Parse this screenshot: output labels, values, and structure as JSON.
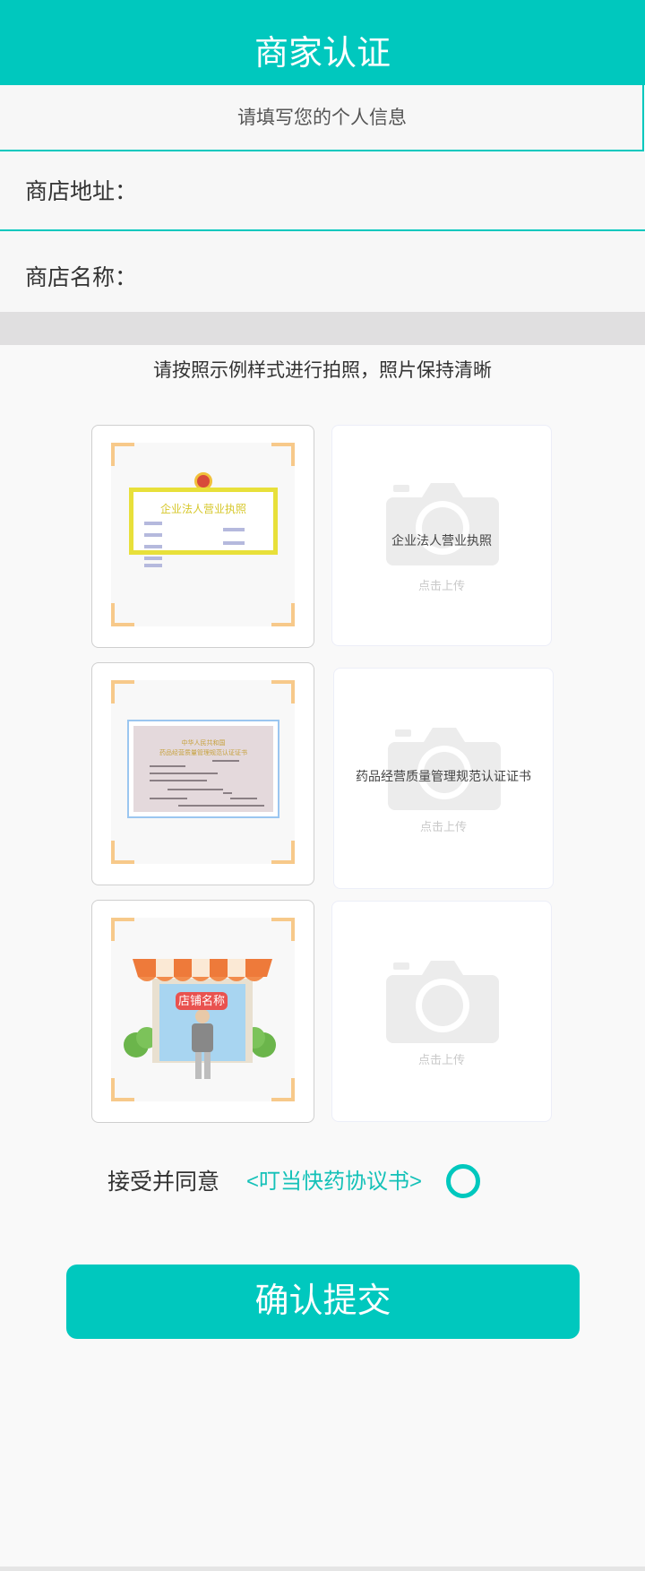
{
  "header": {
    "title": "商家认证"
  },
  "subheader": {
    "text": "请填写您的个人信息"
  },
  "form": {
    "address": {
      "label": "商店地址：",
      "value": ""
    },
    "name": {
      "label": "商店名称：",
      "value": ""
    }
  },
  "instruction": "请按照示例样式进行拍照，照片保持清晰",
  "samples": {
    "license": {
      "title": "企业法人营业执照"
    },
    "gsp": {
      "title": "中华人民共和国",
      "subtitle": "药品经营质量管理规范认证证书"
    },
    "shop": {
      "sign": "店铺名称"
    }
  },
  "uploads": [
    {
      "caption": "企业法人营业执照",
      "hint": "点击上传"
    },
    {
      "caption": "药品经营质量管理规范认证证书",
      "hint": "点击上传"
    },
    {
      "caption": "",
      "hint": "点击上传"
    }
  ],
  "agreement": {
    "text": "接受并同意",
    "link": "<叮当快药协议书>",
    "checked": false
  },
  "submit": {
    "label": "确认提交"
  },
  "colors": {
    "primary": "#00c8be",
    "corner": "#f7c98a",
    "band": "#e0dfe0"
  },
  "icons": [
    "camera-icon",
    "emblem-icon",
    "radio-icon"
  ]
}
